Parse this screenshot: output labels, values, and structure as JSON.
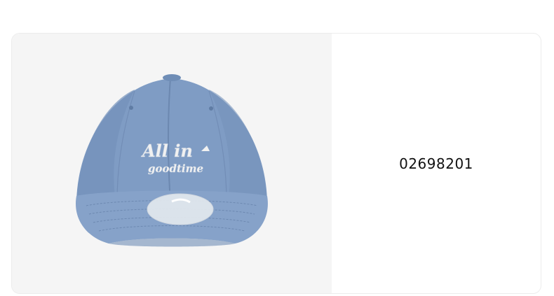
{
  "product": {
    "code": "02698201",
    "image": {
      "subject": "blue-baseball-cap",
      "embroidery_line1": "All in",
      "embroidery_line2": "goodtime",
      "cap_color": "#7f9cc4",
      "background_color": "#f5f5f5"
    }
  }
}
